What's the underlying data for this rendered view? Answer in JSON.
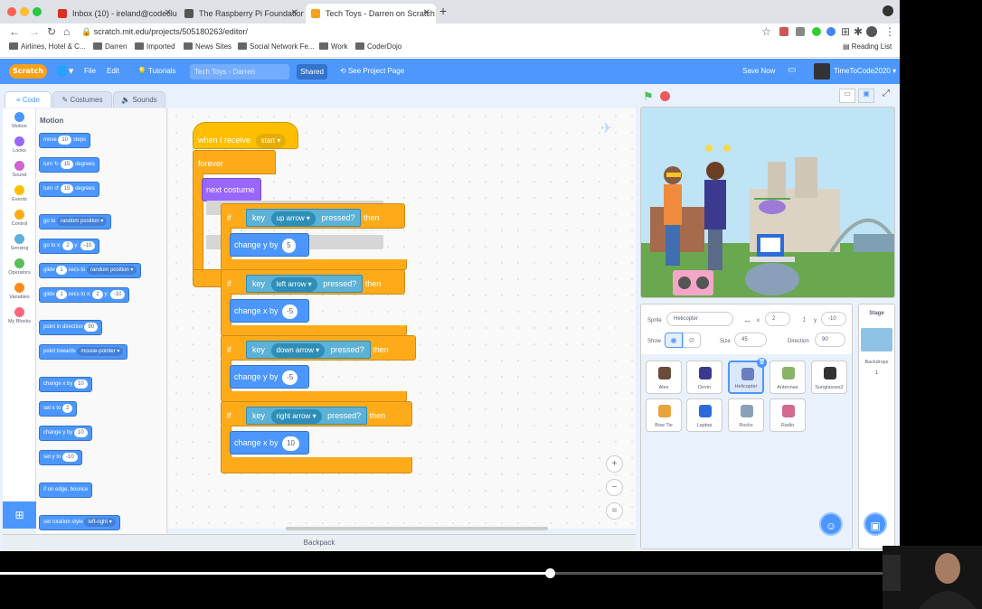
{
  "browser": {
    "tabs": [
      {
        "label": "Inbox (10) - ireland@codeclub...",
        "active": false
      },
      {
        "label": "The Raspberry Pi Foundation - ...",
        "active": false
      },
      {
        "label": "Tech Toys - Darren on Scratch",
        "active": true
      }
    ],
    "url": "scratch.mit.edu/projects/505180263/editor/",
    "bookmarks": [
      "Airlines, Hotel & C...",
      "Darren",
      "Imported",
      "News Sites",
      "Social Network Fe...",
      "Work",
      "CoderDojo"
    ],
    "reading_list": "Reading List"
  },
  "menu": {
    "logo": "Scratch",
    "file": "File",
    "edit": "Edit",
    "tutorials": "Tutorials",
    "project_title": "Tech Toys - Darren",
    "shared": "Shared",
    "see_project_page": "See Project Page",
    "save_now": "Save Now",
    "username": "TimeToCode2020"
  },
  "editor_tabs": {
    "code": "Code",
    "costumes": "Costumes",
    "sounds": "Sounds"
  },
  "categories": [
    {
      "label": "Motion",
      "color": "#4c97ff"
    },
    {
      "label": "Looks",
      "color": "#9966ff"
    },
    {
      "label": "Sound",
      "color": "#cf63cf"
    },
    {
      "label": "Events",
      "color": "#ffbf00"
    },
    {
      "label": "Control",
      "color": "#ffab19"
    },
    {
      "label": "Sensing",
      "color": "#5cb1d6"
    },
    {
      "label": "Operators",
      "color": "#59c059"
    },
    {
      "label": "Variables",
      "color": "#ff8c1a"
    },
    {
      "label": "My Blocks",
      "color": "#ff6680"
    }
  ],
  "palette": {
    "title": "Motion",
    "move": {
      "pre": "move",
      "val": "10",
      "post": "steps"
    },
    "turn_right": {
      "pre": "turn",
      "val": "15",
      "post": "degrees"
    },
    "turn_left": {
      "pre": "turn",
      "val": "15",
      "post": "degrees"
    },
    "goto": {
      "pre": "go to",
      "dd": "random position"
    },
    "goto_xy": {
      "pre": "go to x:",
      "x": "2",
      "mid": "y:",
      "y": "-10"
    },
    "glide_to": {
      "pre": "glide",
      "val": "1",
      "mid": "secs to",
      "dd": "random position"
    },
    "glide_xy": {
      "pre": "glide",
      "val": "1",
      "mid": "secs to x:",
      "x": "2",
      "ylbl": "y:",
      "y": "-10"
    },
    "point_dir": {
      "pre": "point in direction",
      "val": "90"
    },
    "point_towards": {
      "pre": "point towards",
      "dd": "mouse-pointer"
    },
    "change_x": {
      "pre": "change x by",
      "val": "10"
    },
    "set_x": {
      "pre": "set x to",
      "val": "2"
    },
    "change_y": {
      "pre": "change y by",
      "val": "10"
    },
    "set_y": {
      "pre": "set y to",
      "val": "-10"
    },
    "bounce": {
      "pre": "if on edge, bounce"
    },
    "rotation": {
      "pre": "set rotation style",
      "dd": "left-right"
    }
  },
  "script": {
    "hat": {
      "label": "when I receive",
      "dd": "start"
    },
    "forever": "forever",
    "next_costume": "next costume",
    "if_label": "if",
    "then_label": "then",
    "key_label": "key",
    "pressed_label": "pressed?",
    "ifs": [
      {
        "key": "up arrow",
        "action": "change y by",
        "val": "5"
      },
      {
        "key": "left arrow",
        "action": "change x by",
        "val": "-5"
      },
      {
        "key": "down arrow",
        "action": "change y by",
        "val": "-5"
      },
      {
        "key": "right arrow",
        "action": "change x by",
        "val": "10"
      }
    ]
  },
  "zoom": {
    "in": "+",
    "out": "−",
    "reset": "="
  },
  "backpack": "Backpack",
  "sprite_info": {
    "sprite_label": "Sprite",
    "sprite_name": "Helicopter",
    "x_label": "x",
    "x": "2",
    "y_label": "y",
    "y": "-10",
    "show_label": "Show",
    "size_label": "Size",
    "size": "45",
    "direction_label": "Direction",
    "direction": "90"
  },
  "sprites": [
    {
      "name": "Alex",
      "selected": false
    },
    {
      "name": "Devin",
      "selected": false
    },
    {
      "name": "Helicopter",
      "selected": true
    },
    {
      "name": "Antennae",
      "selected": false
    },
    {
      "name": "Sunglasses2",
      "selected": false
    },
    {
      "name": "Bow Tie",
      "selected": false
    },
    {
      "name": "Laptop",
      "selected": false
    },
    {
      "name": "Rocks",
      "selected": false
    },
    {
      "name": "Radio",
      "selected": false
    }
  ],
  "stage_pane": {
    "title": "Stage",
    "backdrops_label": "Backdrops",
    "backdrops_count": "1"
  },
  "video": {
    "progress": 0.56
  }
}
